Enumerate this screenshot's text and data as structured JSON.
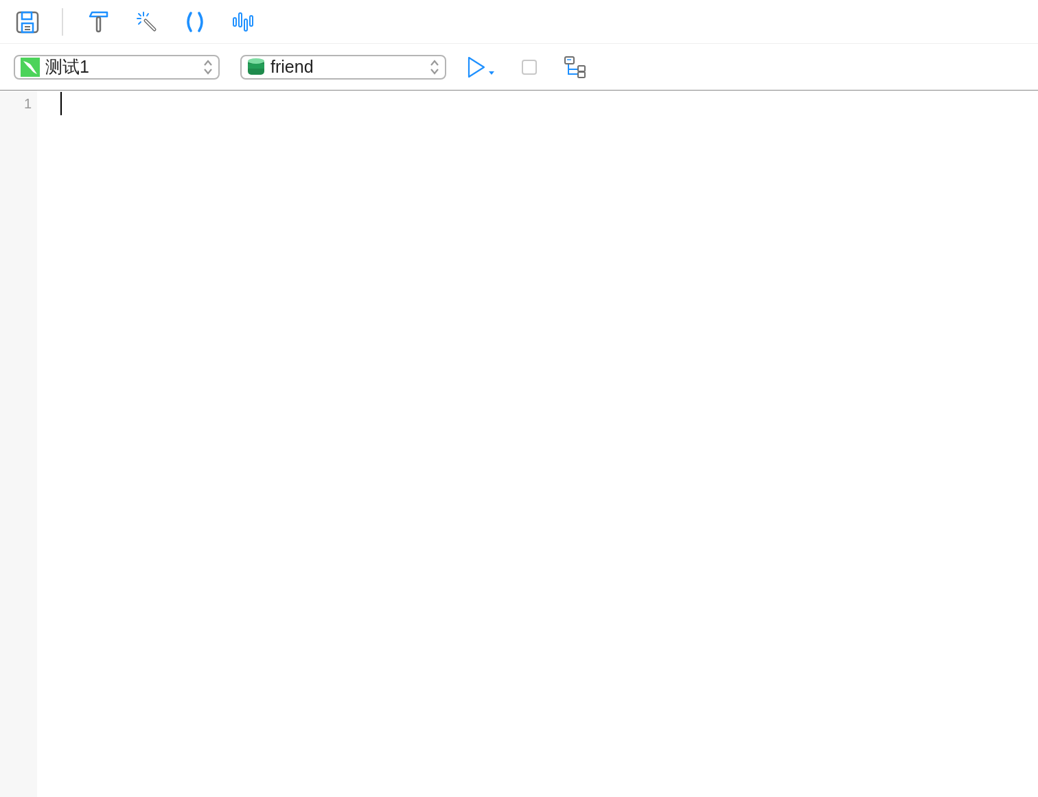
{
  "toolbar": {
    "stop_disabled": true
  },
  "query_bar": {
    "connection": "测试1",
    "database": "friend"
  },
  "editor": {
    "line_numbers": [
      "1"
    ]
  }
}
